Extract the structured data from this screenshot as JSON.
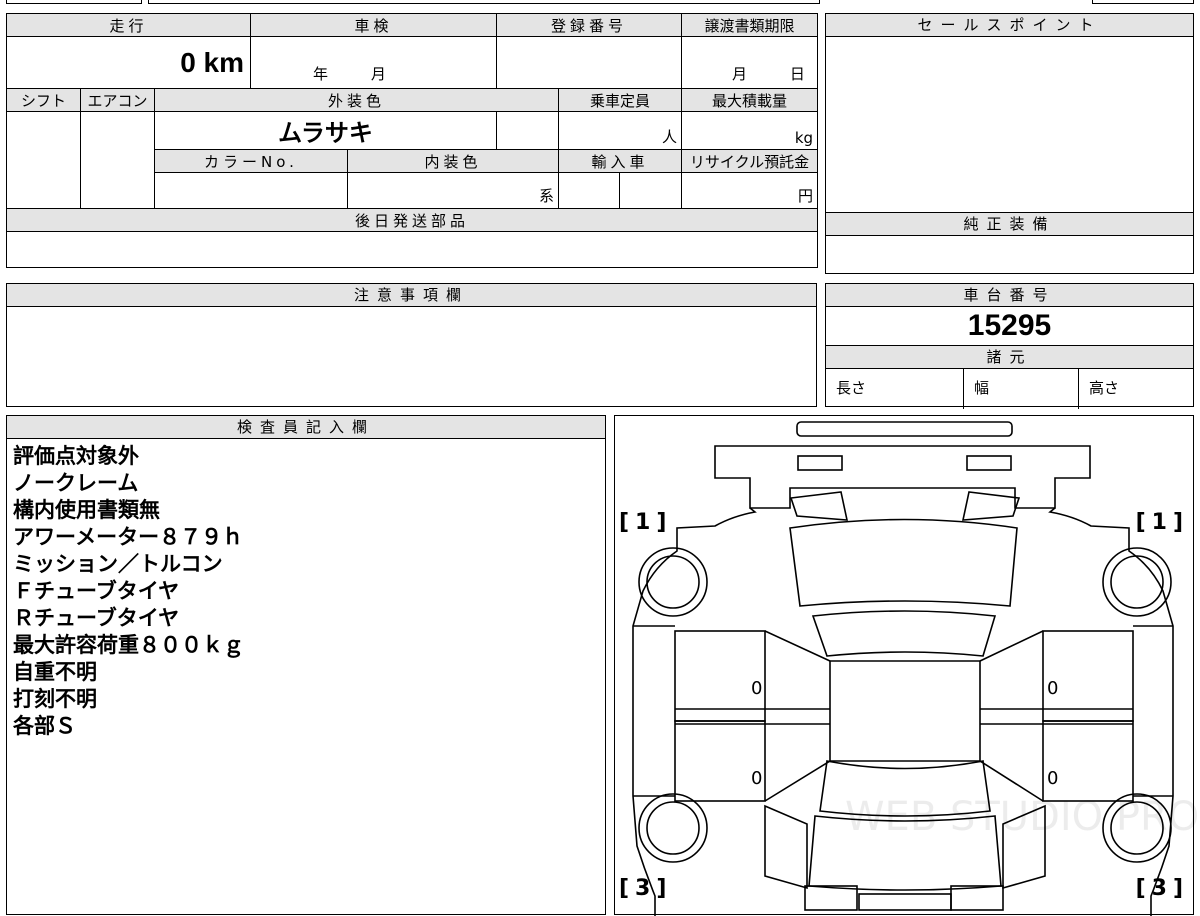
{
  "top_table": {
    "headers": {
      "mileage": "走行",
      "inspection": "車検",
      "registration_no": "登録番号",
      "transfer_deadline": "譲渡書類期限"
    },
    "mileage_value": "0 km",
    "inspection_year": "年",
    "inspection_month": "月",
    "deadline_month": "月",
    "deadline_day": "日",
    "headers2": {
      "shift": "シフト",
      "aircon": "エアコン",
      "exterior_color": "外装色",
      "capacity": "乗車定員",
      "max_load": "最大積載量"
    },
    "exterior_color_value": "ムラサキ",
    "capacity_unit": "人",
    "max_load_unit": "kg",
    "headers3": {
      "color_no": "カラーNo.",
      "interior_color": "内装色",
      "import": "輸入車",
      "recycle": "リサイクル預託金"
    },
    "interior_suffix": "系",
    "recycle_unit": "円",
    "later_parts": "後日発送部品"
  },
  "sales_point": {
    "title": "セールスポイント"
  },
  "genuine_equipment": {
    "title": "純正装備"
  },
  "remarks": {
    "title": "注意事項欄"
  },
  "chassis": {
    "title": "車台番号",
    "number": "15295",
    "specs_title": "諸元",
    "length": "長さ",
    "width": "幅",
    "height": "高さ"
  },
  "inspector": {
    "title": "検査員記入欄",
    "lines": [
      "評価点対象外",
      "ノークレーム",
      "構内使用書類無",
      "アワーメーター８７９ｈ",
      "ミッション／トルコン",
      "Ｆチューブタイヤ",
      "Ｒチューブタイヤ",
      "最大許容荷重８００ｋｇ",
      "自重不明",
      "打刻不明",
      "各部Ｓ"
    ]
  },
  "diagram": {
    "tl": "[1]",
    "tr": "[1]",
    "bl": "[3]",
    "br": "[3]",
    "left_upper": "0",
    "left_lower": "0",
    "right_upper": "0",
    "right_lower": "0",
    "watermark": "WEB STUDIO PRO"
  }
}
